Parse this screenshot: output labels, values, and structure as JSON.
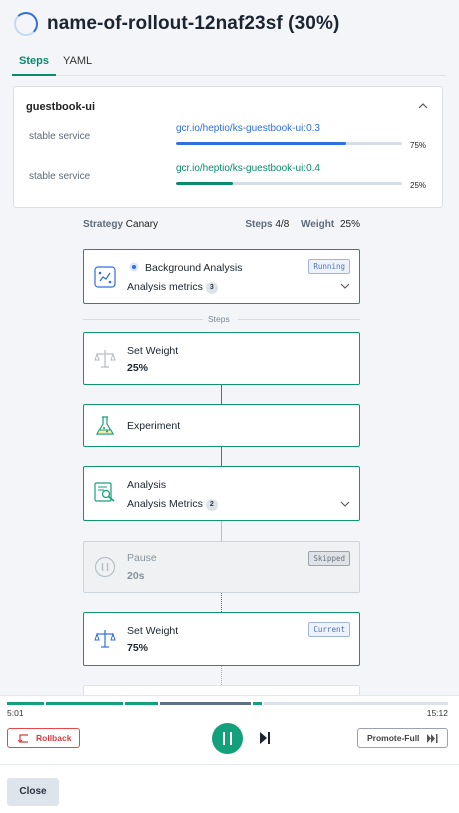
{
  "header": {
    "title": "name-of-rollout-12naf23sf (30%)"
  },
  "tabs": [
    {
      "label": "Steps",
      "active": true
    },
    {
      "label": "YAML",
      "active": false
    }
  ],
  "service": {
    "name": "guestbook-ui",
    "rows": [
      {
        "label": "stable service",
        "image": "gcr.io/heptio/ks-guestbook-ui:0.3",
        "percent": 75,
        "percent_label": "75%",
        "color": "#2f6fde"
      },
      {
        "label": "stable service",
        "image": "gcr.io/heptio/ks-guestbook-ui:0.4",
        "percent": 25,
        "percent_label": "25%",
        "color": "#0b8a6d"
      }
    ]
  },
  "strategy": {
    "strategy_key": "Strategy",
    "strategy_value": "Canary",
    "steps_key": "Steps",
    "steps_value": "4/8",
    "weight_key": "Weight",
    "weight_value": "25%"
  },
  "background_analysis": {
    "title": "Background Analysis",
    "status": "Running",
    "metrics_label": "Analysis metrics",
    "metrics_count": "3"
  },
  "divider_label": "Steps",
  "steps": [
    {
      "type": "set-weight",
      "title": "Set Weight",
      "value": "25%"
    },
    {
      "type": "experiment",
      "title": "Experiment"
    },
    {
      "type": "analysis",
      "title": "Analysis",
      "metrics_label": "Analysis Metrics",
      "metrics_count": "2"
    },
    {
      "type": "pause",
      "title": "Pause",
      "value": "20s",
      "status": "Skipped"
    },
    {
      "type": "set-weight",
      "title": "Set Weight",
      "value": "75%",
      "status": "Current"
    }
  ],
  "timeline": {
    "start": "5:01",
    "end": "15:12"
  },
  "controls": {
    "rollback_label": "Rollback",
    "promote_label": "Promote-Full",
    "close_label": "Close"
  },
  "colors": {
    "accent": "#14a07a",
    "blue": "#2f6fde",
    "danger": "#e5474b"
  }
}
